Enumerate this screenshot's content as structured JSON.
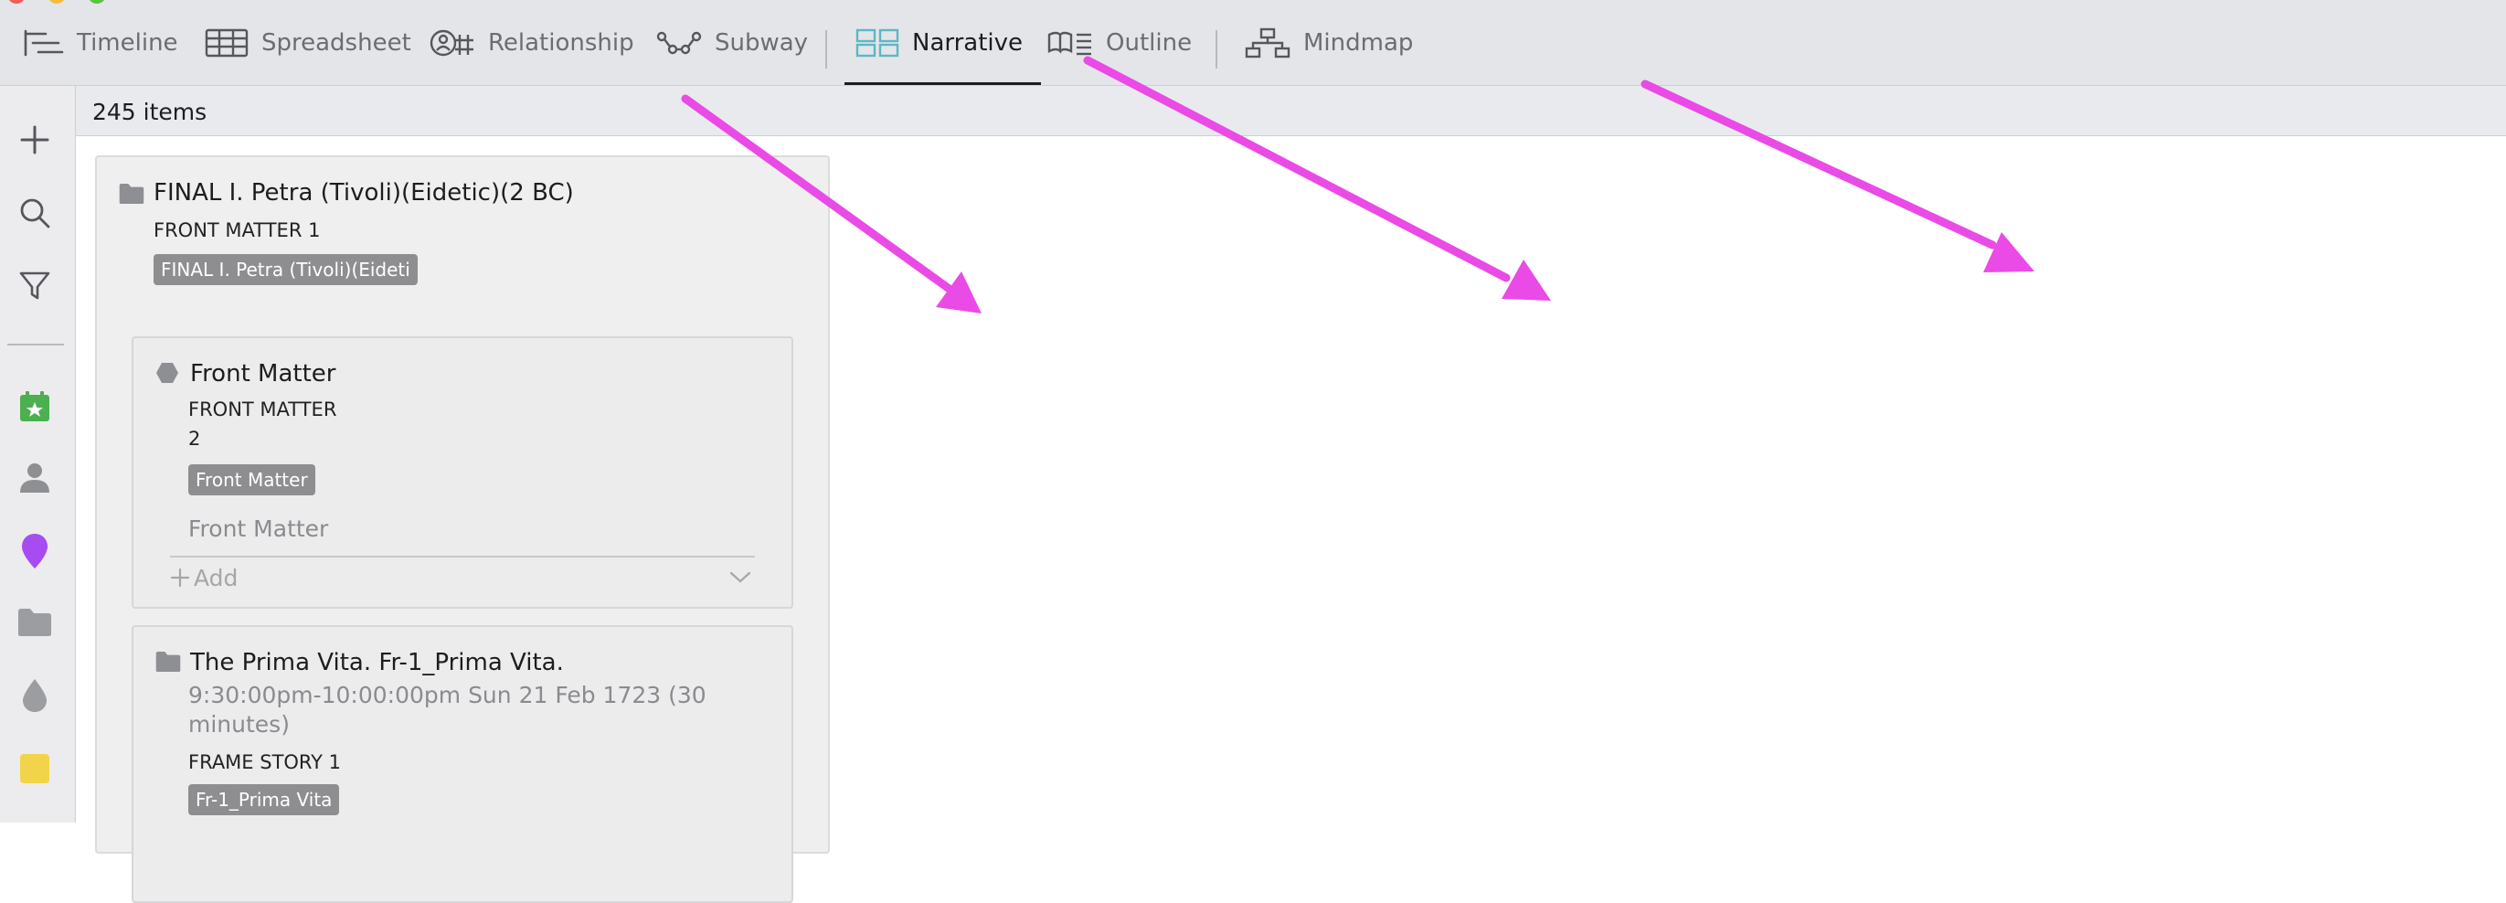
{
  "toolbar": {
    "tabs": [
      {
        "label": "Timeline",
        "icon": "timeline-icon"
      },
      {
        "label": "Spreadsheet",
        "icon": "spreadsheet-icon"
      },
      {
        "label": "Relationship",
        "icon": "relationship-icon"
      },
      {
        "label": "Subway",
        "icon": "subway-icon"
      },
      {
        "label": "Narrative",
        "icon": "narrative-icon",
        "active": true
      },
      {
        "label": "Outline",
        "icon": "outline-icon"
      },
      {
        "label": "Mindmap",
        "icon": "mindmap-icon"
      }
    ]
  },
  "rail": {
    "icons": [
      "plus-icon",
      "search-icon",
      "filter-icon",
      "calendar-star-icon",
      "person-icon",
      "location-pin-icon",
      "folder-icon",
      "drop-icon",
      "note-icon"
    ]
  },
  "count": {
    "label": "245 items"
  },
  "column": {
    "title": "FINAL I. Petra (Tivoli)(Eidetic)(2 BC)",
    "subtitle": "FRONT MATTER 1",
    "tag": "FINAL I. Petra (Tivoli)(Eideti"
  },
  "card1": {
    "title": "Front Matter",
    "line1": "FRONT MATTER",
    "line2": "2",
    "tag": "Front Matter",
    "preview": "Front Matter",
    "add_label": "Add"
  },
  "card2": {
    "title": "The Prima Vita. Fr-1_Prima Vita.",
    "time_line1": "9:30:00pm-10:00:00pm Sun 21 Feb 1723 (30",
    "time_line2": "minutes)",
    "subtitle": "FRAME STORY 1",
    "tag": "Fr-1_Prima Vita"
  },
  "colors": {
    "arrow": "#ea4ae6",
    "accent_teal": "#5bb8c4",
    "pin_purple": "#a64cf0",
    "calendar_green": "#4caf50",
    "note_yellow": "#f2d44a"
  }
}
